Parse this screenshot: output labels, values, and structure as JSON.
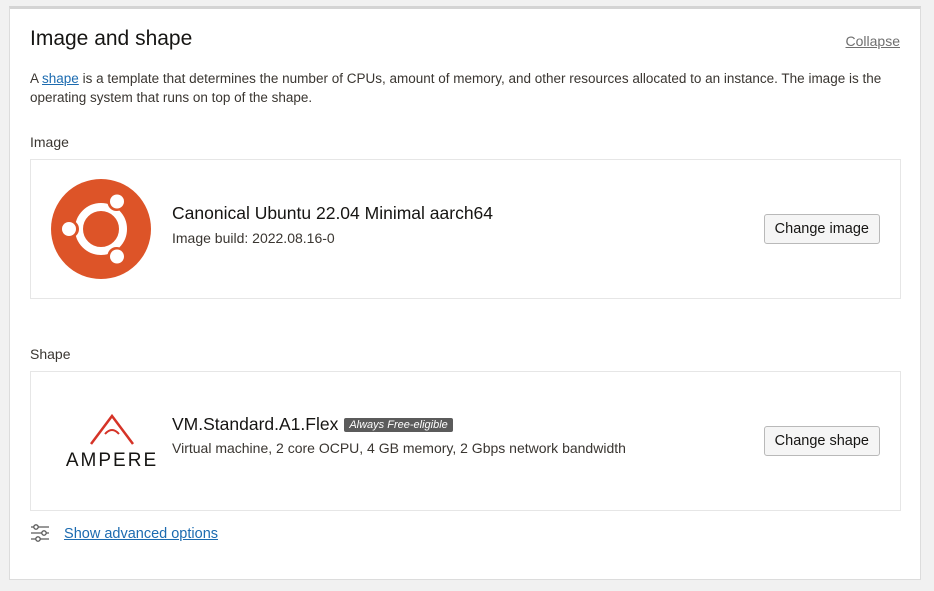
{
  "section": {
    "title": "Image and shape",
    "collapse_label": "Collapse",
    "description_prefix": "A ",
    "description_link": "shape",
    "description_suffix": " is a template that determines the number of CPUs, amount of memory, and other resources allocated to an instance. The image is the operating system that runs on top of the shape."
  },
  "image": {
    "label": "Image",
    "logo_icon": "ubuntu-logo",
    "name": "Canonical Ubuntu 22.04 Minimal aarch64",
    "build": "Image build: 2022.08.16-0",
    "button_label": "Change image",
    "logo_color": "#dd5428"
  },
  "shape": {
    "label": "Shape",
    "logo_icon": "ampere-logo",
    "logo_text": "AMPERE",
    "name": "VM.Standard.A1.Flex",
    "badge": "Always Free-eligible",
    "details": "Virtual machine, 2 core OCPU, 4 GB memory, 2 Gbps network bandwidth",
    "button_label": "Change shape",
    "logo_color": "#d53327"
  },
  "advanced": {
    "icon": "sliders-icon",
    "link_label": "Show advanced options"
  },
  "colors": {
    "link": "#1c6bb0",
    "badge_bg": "#5b5b5b"
  }
}
